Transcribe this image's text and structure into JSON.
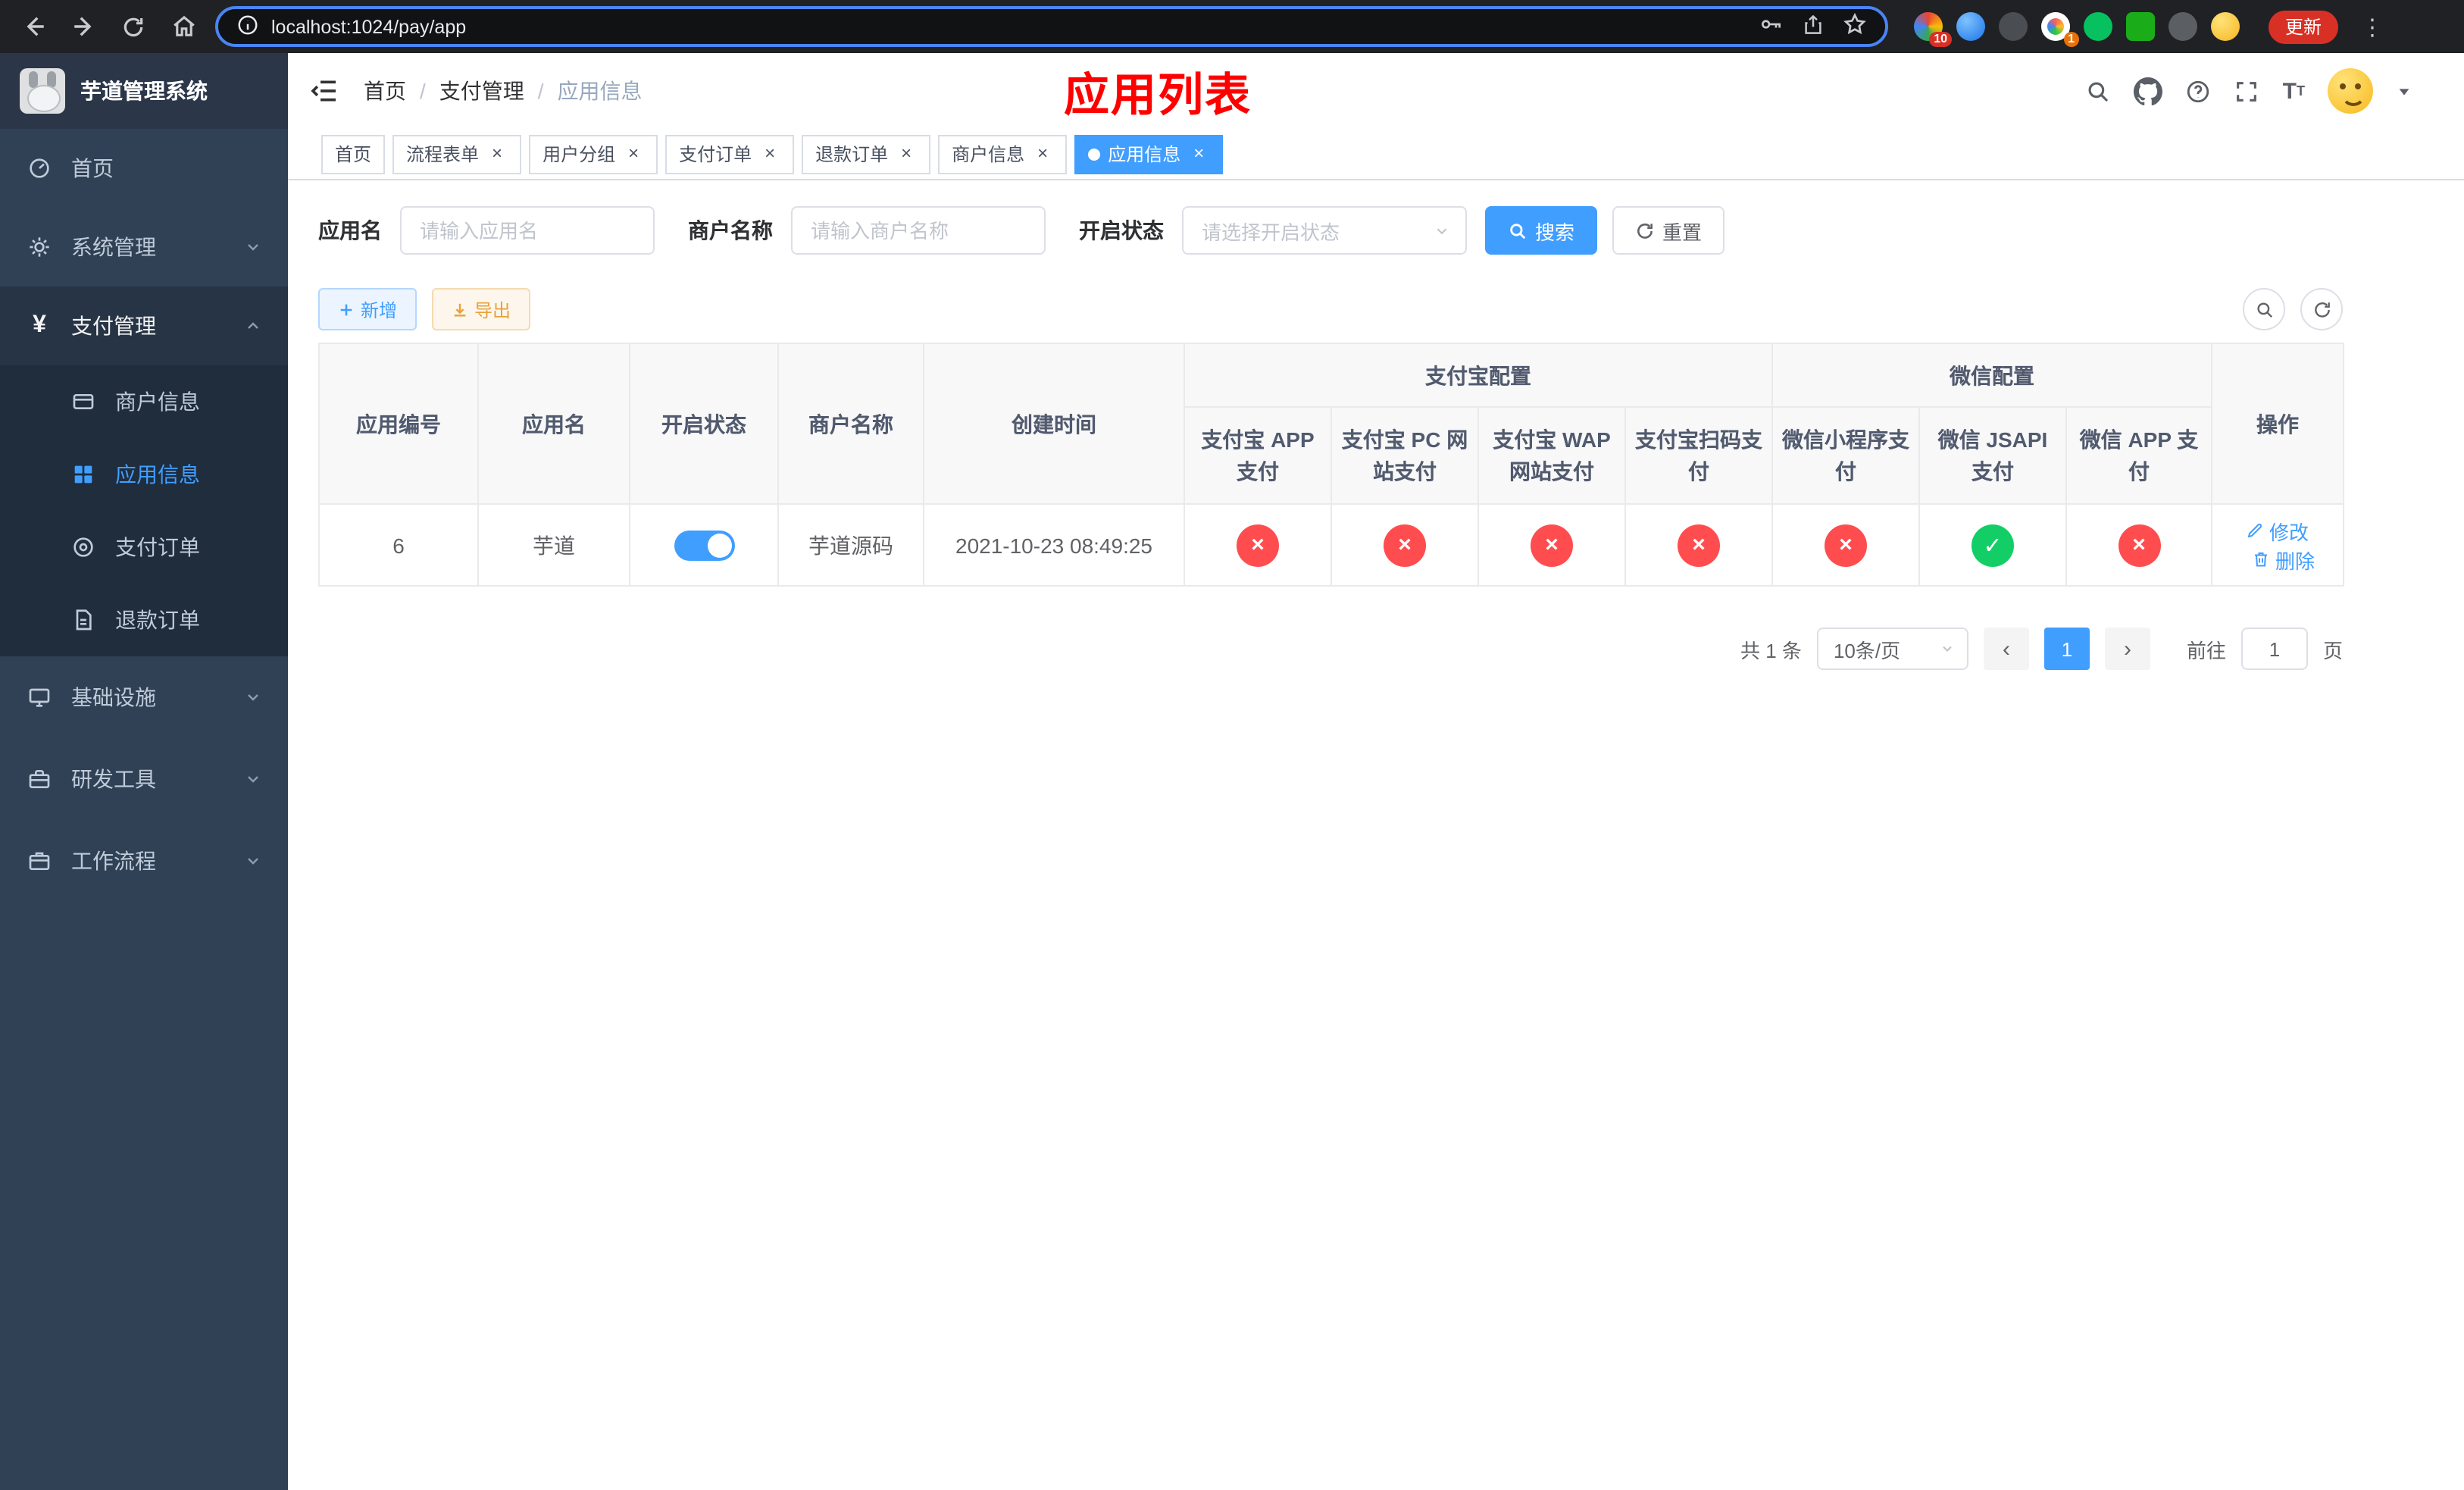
{
  "theme": {
    "primary": "#409eff",
    "success": "#13ce66",
    "danger": "#ff4d4f",
    "warning": "#e6a23c",
    "sidebar_bg": "#304156",
    "submenu_bg": "#1f2d3d",
    "title_red": "#ff0000"
  },
  "glyphs": {
    "yes": "✓",
    "no": "×"
  },
  "browser": {
    "url": "localhost:1024/pay/app",
    "update_label": "更新",
    "ext_badges": {
      "first": "10",
      "second": "1"
    }
  },
  "sidebar": {
    "title": "芋道管理系统",
    "menu": [
      {
        "label": "首页"
      },
      {
        "label": "系统管理"
      },
      {
        "label": "支付管理"
      }
    ],
    "submenu": [
      {
        "label": "商户信息"
      },
      {
        "label": "应用信息"
      },
      {
        "label": "支付订单"
      },
      {
        "label": "退款订单"
      }
    ],
    "menu_bottom": [
      {
        "label": "基础设施"
      },
      {
        "label": "研发工具"
      },
      {
        "label": "工作流程"
      }
    ]
  },
  "navbar": {
    "breadcrumb": [
      "首页",
      "支付管理",
      "应用信息"
    ],
    "page_title": "应用列表"
  },
  "tabs": [
    {
      "label": "首页"
    },
    {
      "label": "流程表单"
    },
    {
      "label": "用户分组"
    },
    {
      "label": "支付订单"
    },
    {
      "label": "退款订单"
    },
    {
      "label": "商户信息"
    },
    {
      "label": "应用信息"
    }
  ],
  "filters": {
    "app_name_label": "应用名",
    "app_name_placeholder": "请输入应用名",
    "merchant_label": "商户名称",
    "merchant_placeholder": "请输入商户名称",
    "status_label": "开启状态",
    "status_placeholder": "请选择开启状态",
    "search_label": "搜索",
    "reset_label": "重置"
  },
  "toolbar": {
    "add_label": "新增",
    "export_label": "导出"
  },
  "table": {
    "columns": {
      "app_id": "应用编号",
      "app_name": "应用名",
      "status": "开启状态",
      "merchant": "商户名称",
      "created": "创建时间",
      "alipay_group": "支付宝配置",
      "wechat_group": "微信配置",
      "alipay_app": "支付宝 APP 支付",
      "alipay_pc": "支付宝 PC 网站支付",
      "alipay_wap": "支付宝 WAP 网站支付",
      "alipay_qr": "支付宝扫码支付",
      "wx_mini": "微信小程序支付",
      "wx_jsapi": "微信 JSAPI 支付",
      "wx_app": "微信 APP 支付",
      "actions": "操作"
    },
    "rows": [
      {
        "app_id": "6",
        "app_name": "芋道",
        "enabled": true,
        "merchant": "芋道源码",
        "created": "2021-10-23 08:49:25",
        "channels": {
          "alipay_app": false,
          "alipay_pc": false,
          "alipay_wap": false,
          "alipay_qr": false,
          "wx_mini": false,
          "wx_jsapi": true,
          "wx_app": false
        },
        "edit_label": "修改",
        "delete_label": "删除"
      }
    ]
  },
  "pagination": {
    "total": "共 1 条",
    "page_size": "10条/页",
    "prev": "‹",
    "page": "1",
    "next": "›",
    "goto_label": "前往",
    "goto_value": "1",
    "unit": "页"
  }
}
